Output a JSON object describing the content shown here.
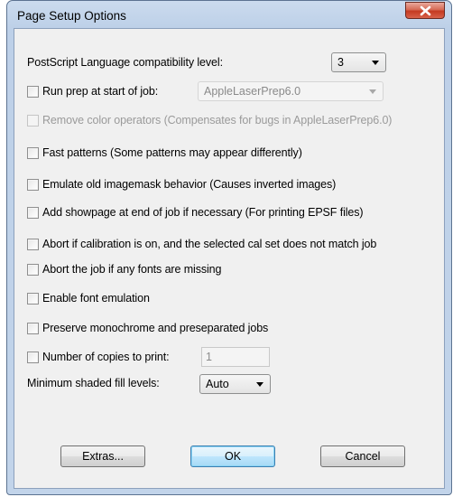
{
  "window": {
    "title": "Page Setup Options"
  },
  "postscript_level": {
    "label": "PostScript Language compatibility level:",
    "value": "3"
  },
  "run_prep": {
    "label": "Run prep at start of job:",
    "checked": false,
    "combo_value": "AppleLaserPrep6.0"
  },
  "remove_color": {
    "label": "Remove color operators  (Compensates for bugs in AppleLaserPrep6.0)",
    "checked": false,
    "disabled": true
  },
  "fast_patterns": {
    "label": "Fast patterns  (Some patterns may appear differently)",
    "checked": false
  },
  "emulate_imagemask": {
    "label": "Emulate old imagemask behavior  (Causes inverted images)",
    "checked": false
  },
  "add_showpage": {
    "label": "Add showpage at end of job if necessary  (For printing EPSF files)",
    "checked": false
  },
  "abort_calibration": {
    "label": "Abort if calibration is on, and the selected cal set does not match job",
    "checked": false
  },
  "abort_fonts": {
    "label": "Abort the job if any fonts are missing",
    "checked": false
  },
  "font_emulation": {
    "label": "Enable font emulation",
    "checked": false
  },
  "preserve_mono": {
    "label": "Preserve monochrome and preseparated jobs",
    "checked": false
  },
  "copies": {
    "label": "Number of copies to print:",
    "checked": false,
    "value": "1"
  },
  "shaded_fill": {
    "label": "Minimum shaded fill levels:",
    "value": "Auto"
  },
  "buttons": {
    "extras": "Extras...",
    "ok": "OK",
    "cancel": "Cancel"
  },
  "colors": {
    "accent": "#3c7fb1",
    "close": "#c43a21"
  }
}
